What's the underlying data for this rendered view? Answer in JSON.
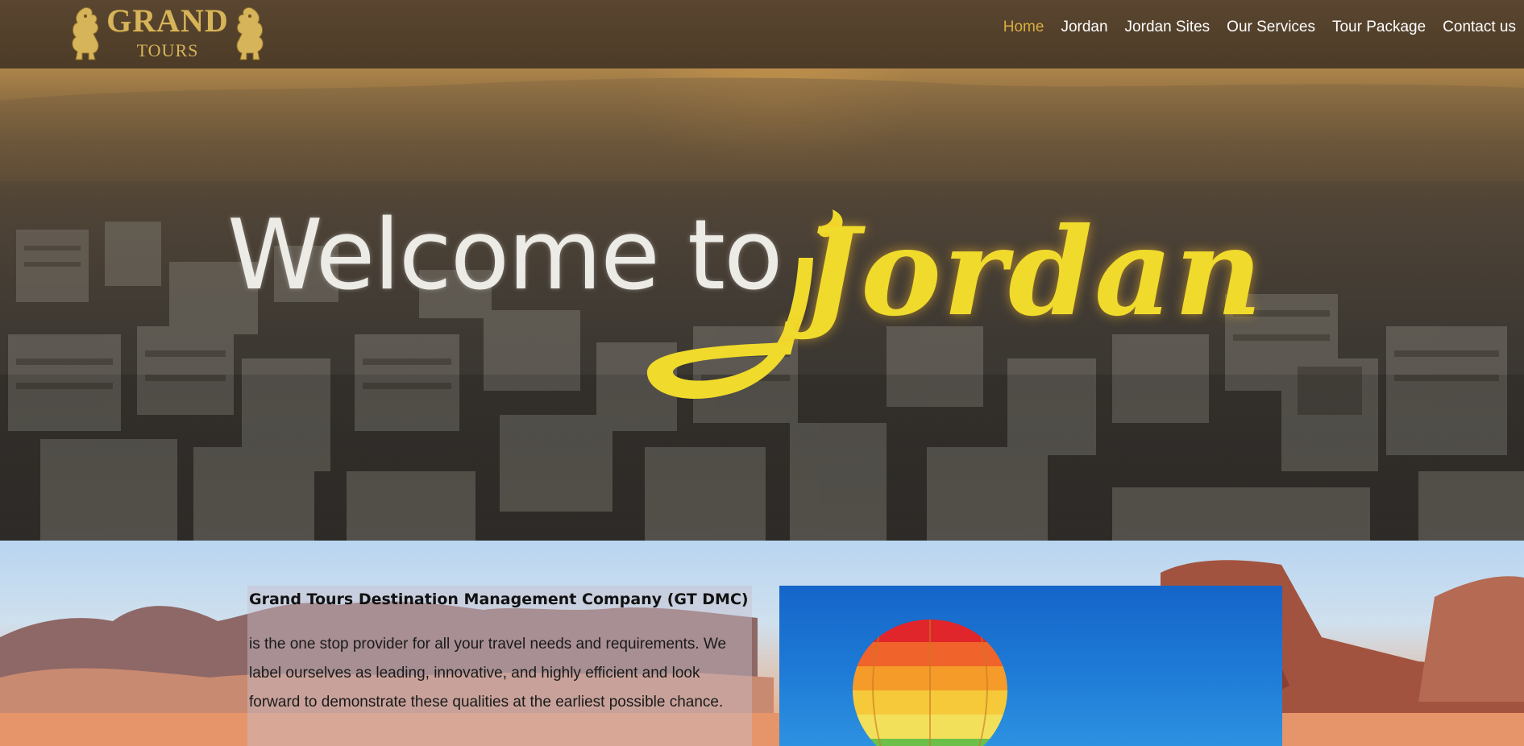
{
  "header": {
    "logo": {
      "brand": "GRAND",
      "sub": "TOURS"
    },
    "nav": [
      {
        "label": "Home",
        "active": true
      },
      {
        "label": "Jordan",
        "active": false
      },
      {
        "label": "Jordan Sites",
        "active": false
      },
      {
        "label": "Our Services",
        "active": false
      },
      {
        "label": "Tour Package",
        "active": false
      },
      {
        "label": "Contact us",
        "active": false
      }
    ]
  },
  "hero": {
    "welcome": "Welcome to",
    "jordan": "Jordan"
  },
  "about": {
    "title": "Grand Tours Destination Management Company (GT DMC)",
    "text": " is the one stop provider for all your travel needs and requirements. We label ourselves as leading, innovative, and highly efficient and look forward to demonstrate these qualities at the earliest possible chance."
  },
  "colors": {
    "header_bg": "#4c3b27",
    "nav_active": "#d9ad3f",
    "nav_text": "#ffffff",
    "logo_gold": "#d6b45a",
    "jordan_yellow": "#f0da2c"
  },
  "icons": [
    "lion-crest-icon"
  ]
}
